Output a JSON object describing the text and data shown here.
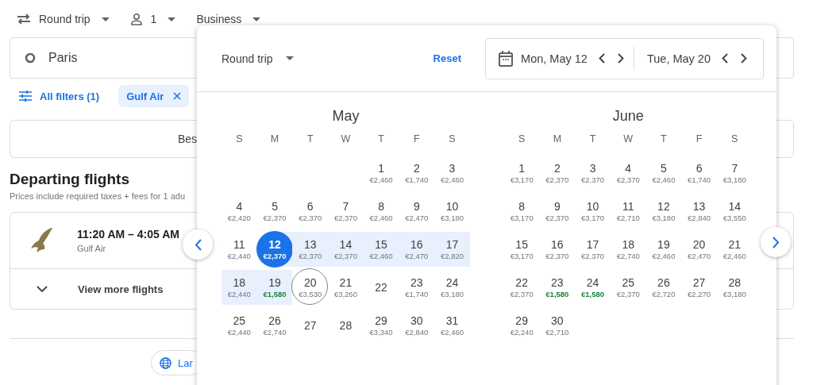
{
  "top_bar": {
    "trip_type": "Round trip",
    "passengers": "1",
    "cabin": "Business"
  },
  "search": {
    "origin": "Paris"
  },
  "filters": {
    "all_filters": "All filters (1)",
    "chips": [
      {
        "label": "Gulf Air"
      }
    ]
  },
  "sort": {
    "label": "Bes"
  },
  "results": {
    "heading": "Departing flights",
    "note": "Prices include required taxes + fees for 1 adu",
    "flights": [
      {
        "times": "11:20 AM – 4:05 AM",
        "airline": "Gulf Air"
      }
    ],
    "more": "View more flights"
  },
  "footer": {
    "language": "Lar"
  },
  "date_picker": {
    "trip_type": "Round trip",
    "reset": "Reset",
    "departure": "Mon, May 12",
    "return": "Tue, May 20",
    "months": [
      {
        "name": "May",
        "weekdays": [
          "S",
          "M",
          "T",
          "W",
          "T",
          "F",
          "S"
        ],
        "weeks": [
          [
            {
              "day": "1",
              "price": "€2,460",
              "cheap": false,
              "start": false,
              "end": false,
              "in_range": false
            },
            {
              "day": "2",
              "price": "€1,740",
              "cheap": false,
              "start": false,
              "end": false,
              "in_range": false
            },
            {
              "day": "3",
              "price": "€2,460",
              "cheap": false,
              "start": false,
              "end": false,
              "in_range": false
            }
          ],
          [
            {
              "day": "4",
              "price": "€2,420",
              "cheap": false,
              "start": false,
              "end": false,
              "in_range": false
            },
            {
              "day": "5",
              "price": "€2,370",
              "cheap": false,
              "start": false,
              "end": false,
              "in_range": false
            },
            {
              "day": "6",
              "price": "€2,370",
              "cheap": false,
              "start": false,
              "end": false,
              "in_range": false
            },
            {
              "day": "7",
              "price": "€2,370",
              "cheap": false,
              "start": false,
              "end": false,
              "in_range": false
            },
            {
              "day": "8",
              "price": "€2,460",
              "cheap": false,
              "start": false,
              "end": false,
              "in_range": false
            },
            {
              "day": "9",
              "price": "€2,470",
              "cheap": false,
              "start": false,
              "end": false,
              "in_range": false
            },
            {
              "day": "10",
              "price": "€3,180",
              "cheap": false,
              "start": false,
              "end": false,
              "in_range": false
            }
          ],
          [
            {
              "day": "11",
              "price": "€2,440",
              "cheap": false,
              "start": false,
              "end": false,
              "in_range": false
            },
            {
              "day": "12",
              "price": "€2,370",
              "cheap": false,
              "start": true,
              "end": false,
              "in_range": true
            },
            {
              "day": "13",
              "price": "€2,370",
              "cheap": false,
              "start": false,
              "end": false,
              "in_range": true
            },
            {
              "day": "14",
              "price": "€2,370",
              "cheap": false,
              "start": false,
              "end": false,
              "in_range": true
            },
            {
              "day": "15",
              "price": "€2,460",
              "cheap": false,
              "start": false,
              "end": false,
              "in_range": true
            },
            {
              "day": "16",
              "price": "€2,470",
              "cheap": false,
              "start": false,
              "end": false,
              "in_range": true
            },
            {
              "day": "17",
              "price": "€2,820",
              "cheap": false,
              "start": false,
              "end": false,
              "in_range": true
            }
          ],
          [
            {
              "day": "18",
              "price": "€2,440",
              "cheap": false,
              "start": false,
              "end": false,
              "in_range": true
            },
            {
              "day": "19",
              "price": "€1,580",
              "cheap": true,
              "start": false,
              "end": false,
              "in_range": true
            },
            {
              "day": "20",
              "price": "€3,530",
              "cheap": false,
              "start": false,
              "end": true,
              "in_range": false
            },
            {
              "day": "21",
              "price": "€3,260",
              "cheap": false,
              "start": false,
              "end": false,
              "in_range": false
            },
            {
              "day": "22",
              "start": false,
              "end": false,
              "in_range": false
            },
            {
              "day": "23",
              "price": "€1,740",
              "cheap": false,
              "start": false,
              "end": false,
              "in_range": false
            },
            {
              "day": "24",
              "price": "€3,180",
              "cheap": false,
              "start": false,
              "end": false,
              "in_range": false
            }
          ],
          [
            {
              "day": "25",
              "price": "€2,440",
              "cheap": false,
              "start": false,
              "end": false,
              "in_range": false
            },
            {
              "day": "26",
              "price": "€2,740",
              "cheap": false,
              "start": false,
              "end": false,
              "in_range": false
            },
            {
              "day": "27",
              "start": false,
              "end": false,
              "in_range": false
            },
            {
              "day": "28",
              "start": false,
              "end": false,
              "in_range": false
            },
            {
              "day": "29",
              "price": "€3,340",
              "cheap": false,
              "start": false,
              "end": false,
              "in_range": false
            },
            {
              "day": "30",
              "price": "€2,840",
              "cheap": false,
              "start": false,
              "end": false,
              "in_range": false
            },
            {
              "day": "31",
              "price": "€2,460",
              "cheap": false,
              "start": false,
              "end": false,
              "in_range": false
            }
          ]
        ]
      },
      {
        "name": "June",
        "weekdays": [
          "S",
          "M",
          "T",
          "W",
          "T",
          "F",
          "S"
        ],
        "weeks": [
          [
            {
              "day": "1",
              "price": "€3,170",
              "cheap": false,
              "start": false,
              "end": false,
              "in_range": false
            },
            {
              "day": "2",
              "price": "€2,370",
              "cheap": false,
              "start": false,
              "end": false,
              "in_range": false
            },
            {
              "day": "3",
              "price": "€2,370",
              "cheap": false,
              "start": false,
              "end": false,
              "in_range": false
            },
            {
              "day": "4",
              "price": "€2,370",
              "cheap": false,
              "start": false,
              "end": false,
              "in_range": false
            },
            {
              "day": "5",
              "price": "€2,460",
              "cheap": false,
              "start": false,
              "end": false,
              "in_range": false
            },
            {
              "day": "6",
              "price": "€1,740",
              "cheap": false,
              "start": false,
              "end": false,
              "in_range": false
            },
            {
              "day": "7",
              "price": "€3,180",
              "cheap": false,
              "start": false,
              "end": false,
              "in_range": false
            }
          ],
          [
            {
              "day": "8",
              "price": "€3,170",
              "cheap": false,
              "start": false,
              "end": false,
              "in_range": false
            },
            {
              "day": "9",
              "price": "€2,370",
              "cheap": false,
              "start": false,
              "end": false,
              "in_range": false
            },
            {
              "day": "10",
              "price": "€3,170",
              "cheap": false,
              "start": false,
              "end": false,
              "in_range": false
            },
            {
              "day": "11",
              "price": "€2,710",
              "cheap": false,
              "start": false,
              "end": false,
              "in_range": false
            },
            {
              "day": "12",
              "price": "€3,180",
              "cheap": false,
              "start": false,
              "end": false,
              "in_range": false
            },
            {
              "day": "13",
              "price": "€2,840",
              "cheap": false,
              "start": false,
              "end": false,
              "in_range": false
            },
            {
              "day": "14",
              "price": "€3,550",
              "cheap": false,
              "start": false,
              "end": false,
              "in_range": false
            }
          ],
          [
            {
              "day": "15",
              "price": "€3,170",
              "cheap": false,
              "start": false,
              "end": false,
              "in_range": false
            },
            {
              "day": "16",
              "price": "€2,370",
              "cheap": false,
              "start": false,
              "end": false,
              "in_range": false
            },
            {
              "day": "17",
              "price": "€2,370",
              "cheap": false,
              "start": false,
              "end": false,
              "in_range": false
            },
            {
              "day": "18",
              "price": "€2,740",
              "cheap": false,
              "start": false,
              "end": false,
              "in_range": false
            },
            {
              "day": "19",
              "price": "€2,460",
              "cheap": false,
              "start": false,
              "end": false,
              "in_range": false
            },
            {
              "day": "20",
              "price": "€2,470",
              "cheap": false,
              "start": false,
              "end": false,
              "in_range": false
            },
            {
              "day": "21",
              "price": "€2,460",
              "cheap": false,
              "start": false,
              "end": false,
              "in_range": false
            }
          ],
          [
            {
              "day": "22",
              "price": "€2,370",
              "cheap": false,
              "start": false,
              "end": false,
              "in_range": false
            },
            {
              "day": "23",
              "price": "€1,580",
              "cheap": true,
              "start": false,
              "end": false,
              "in_range": false
            },
            {
              "day": "24",
              "price": "€1,580",
              "cheap": true,
              "start": false,
              "end": false,
              "in_range": false
            },
            {
              "day": "25",
              "price": "€2,370",
              "cheap": false,
              "start": false,
              "end": false,
              "in_range": false
            },
            {
              "day": "26",
              "price": "€2,720",
              "cheap": false,
              "start": false,
              "end": false,
              "in_range": false
            },
            {
              "day": "27",
              "price": "€2,270",
              "cheap": false,
              "start": false,
              "end": false,
              "in_range": false
            },
            {
              "day": "28",
              "price": "€3,180",
              "cheap": false,
              "start": false,
              "end": false,
              "in_range": false
            }
          ],
          [
            {
              "day": "29",
              "price": "€2,240",
              "cheap": false,
              "start": false,
              "end": false,
              "in_range": false
            },
            {
              "day": "30",
              "price": "€2,710",
              "cheap": false,
              "start": false,
              "end": false,
              "in_range": false
            }
          ]
        ]
      }
    ]
  }
}
